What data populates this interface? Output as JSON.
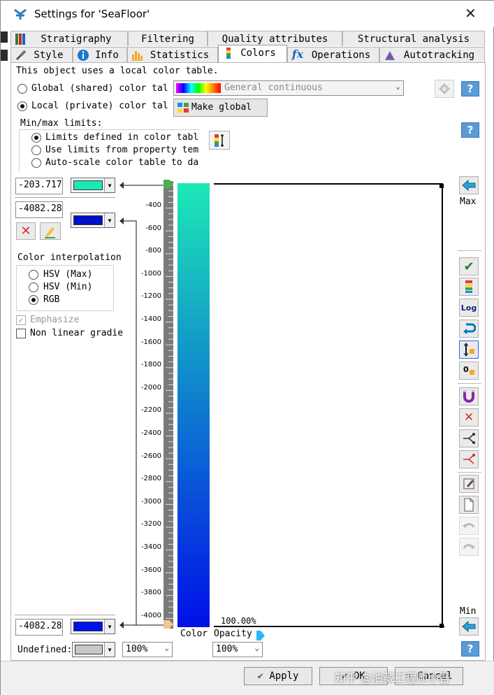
{
  "window": {
    "title": "Settings for 'SeaFloor'",
    "close": "✕"
  },
  "tabs_row1": [
    {
      "label": "Stratigraphy",
      "icon": "stratigraphy-icon"
    },
    {
      "label": "Filtering"
    },
    {
      "label": "Quality attributes"
    },
    {
      "label": "Structural analysis"
    }
  ],
  "tabs_row2": [
    {
      "label": "Style",
      "icon": "brush-icon"
    },
    {
      "label": "Info",
      "icon": "info-icon"
    },
    {
      "label": "Statistics",
      "icon": "bar-chart-icon"
    },
    {
      "label": "Colors",
      "icon": "color-bar-icon",
      "active": true
    },
    {
      "label": "Operations",
      "icon": "fx-icon"
    },
    {
      "label": "Autotracking",
      "icon": "autotrack-icon"
    }
  ],
  "colors": {
    "local_note": "This object uses a local color table.",
    "global_label": "Global (shared) color tal",
    "local_label": "Local (private) color tal",
    "global_table": "General continuous",
    "make_global": "Make global",
    "minmax_label": "Min/max limits:",
    "limits": [
      "Limits defined in color tabl",
      "Use limits from property tem",
      "Auto-scale color table to da"
    ],
    "top_value": "-203.717",
    "upper_value": "-4082.28",
    "bottom_value": "-4082.28",
    "color_top": "#1de9b6",
    "color_upper": "#0010c8",
    "color_bottom": "#0010e8",
    "interp_label": "Color interpolation",
    "interp_options": [
      "HSV (Max)",
      "HSV (Min)",
      "RGB"
    ],
    "emphasize": "Emphasize",
    "nonlinear": "Non linear gradie",
    "undefined_label": "Undefined:",
    "undefined_opacity": "100%",
    "opacity_value": "100%",
    "opacity_pct": "100.00%",
    "color_caption": "Color",
    "opacity_caption": "Opacity",
    "max_label": "Max",
    "min_label": "Min",
    "ticks": [
      "-400",
      "-600",
      "-800",
      "-1000",
      "-1200",
      "-1400",
      "-1600",
      "-1800",
      "-2000",
      "-2200",
      "-2400",
      "-2600",
      "-2800",
      "-3000",
      "-3200",
      "-3400",
      "-3600",
      "-3800",
      "-4000"
    ]
  },
  "buttons": {
    "apply": "Apply",
    "ok": "OK",
    "cancel": "Cancel"
  },
  "watermark": "知乎 @油藏工程师小吾"
}
